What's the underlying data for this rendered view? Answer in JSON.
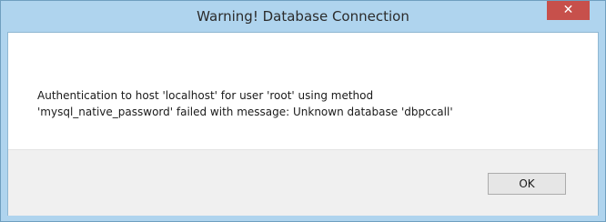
{
  "dialog": {
    "title": "Warning! Database Connection",
    "close_glyph": "✕",
    "message_lines": [
      "Authentication to host 'localhost' for user 'root' using method",
      "'mysql_native_password' failed with message: Unknown database 'dbpccall'"
    ],
    "ok_label": "OK"
  },
  "colors": {
    "titlebar": "#afd4ee",
    "close_button": "#c7504b",
    "footer": "#f0f0f0"
  }
}
